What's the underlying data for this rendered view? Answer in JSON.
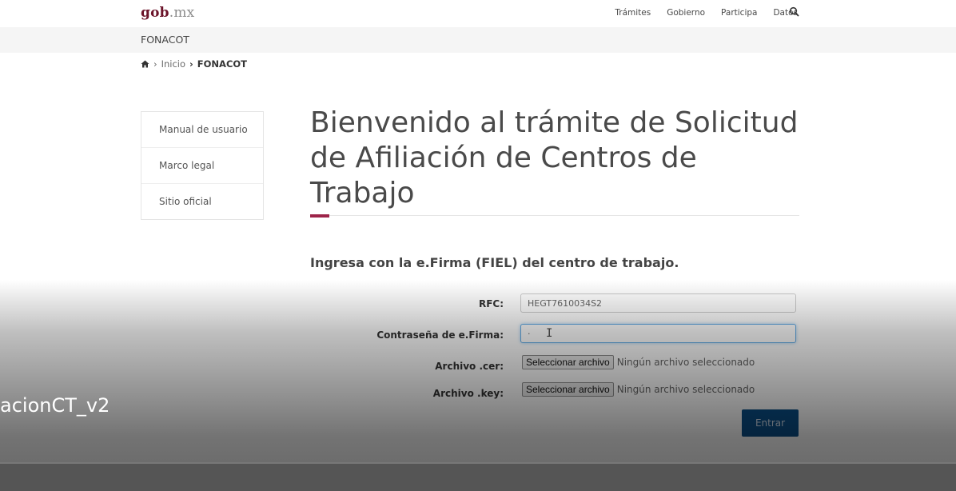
{
  "header": {
    "logo_main": "gob",
    "logo_suffix": ".mx",
    "nav": [
      "Trámites",
      "Gobierno",
      "Participa",
      "Datos"
    ]
  },
  "subheader": {
    "title": "FONACOT"
  },
  "breadcrumb": {
    "sep1": "›",
    "home": "Inicio",
    "sep2": "›",
    "current": "FONACOT"
  },
  "sidebar": {
    "items": [
      {
        "label": "Manual de usuario"
      },
      {
        "label": "Marco legal"
      },
      {
        "label": "Sitio oficial"
      }
    ]
  },
  "main": {
    "title": "Bienvenido al trámite de Solicitud de Afiliación de Centros de Trabajo",
    "intro": "Ingresa con la e.Firma (FIEL) del centro de trabajo."
  },
  "form": {
    "rfc_label": "RFC:",
    "rfc_value": "HEGT7610034S2",
    "password_label": "Contraseña de e.Firma:",
    "password_value": "·",
    "cer_label": "Archivo .cer:",
    "key_label": "Archivo .key:",
    "file_button": "Seleccionar archivo",
    "file_status": "Ningún archivo seleccionado",
    "submit_label": "Entrar"
  },
  "overlay": {
    "title": "acionCT_v2"
  },
  "colors": {
    "brand": "#9d2449",
    "logo": "#6b1329",
    "button": "#0a4f89"
  },
  "icons": {
    "search": "search-icon",
    "home": "home-icon",
    "text_cursor": "text-cursor-icon"
  }
}
